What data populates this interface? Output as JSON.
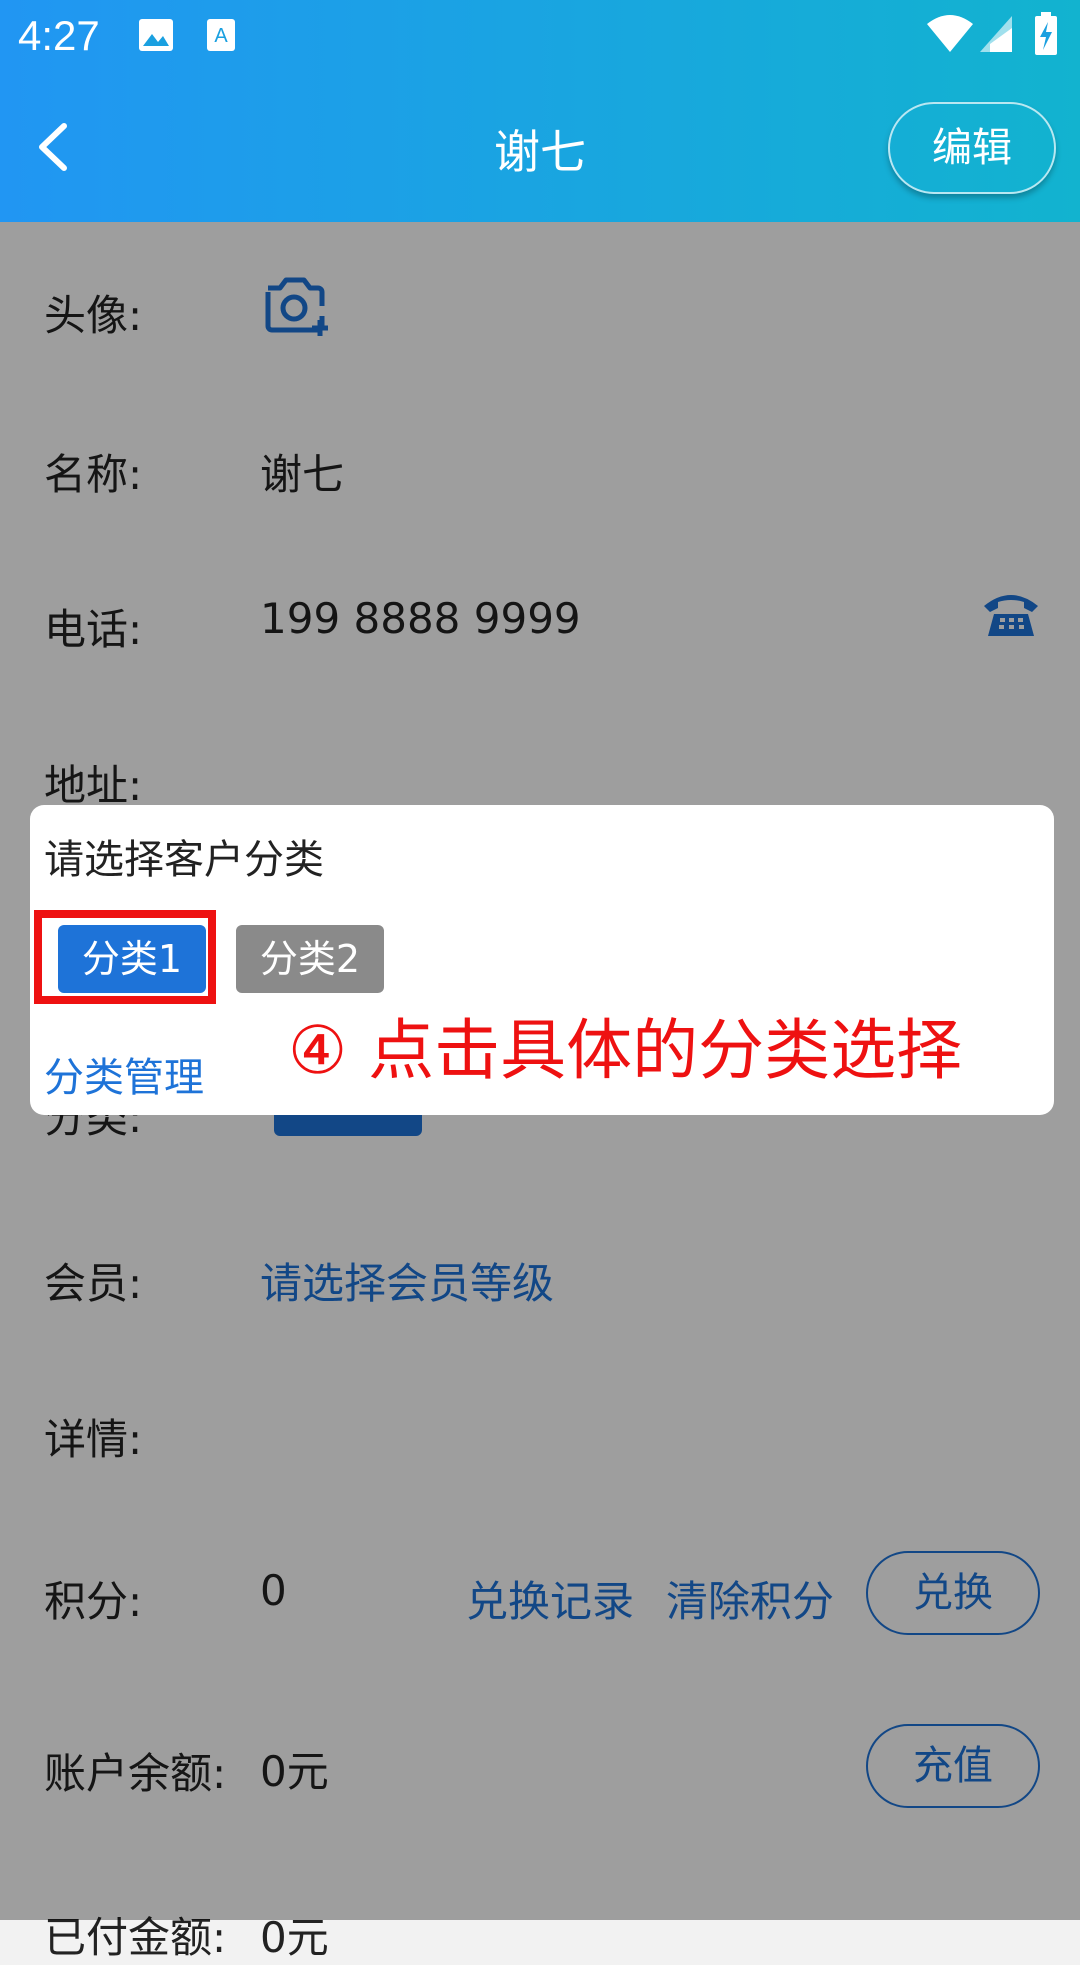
{
  "status_bar": {
    "time": "4:27"
  },
  "app_bar": {
    "title": "谢七",
    "edit_label": "编辑"
  },
  "rows": {
    "avatar": {
      "label": "头像:"
    },
    "name": {
      "label": "名称:",
      "value": "谢七"
    },
    "phone": {
      "label": "电话:",
      "value": "199 8888 9999"
    },
    "address": {
      "label": "地址:"
    },
    "category": {
      "label": "分类:"
    },
    "member": {
      "label": "会员:",
      "value": "请选择会员等级"
    },
    "details": {
      "label": "详情:"
    },
    "points": {
      "label": "积分:",
      "value": "0",
      "exchange_record": "兑换记录",
      "clear_points": "清除积分",
      "exchange": "兑换"
    },
    "balance": {
      "label": "账户余额:",
      "value": "0元",
      "recharge": "充值"
    },
    "paid": {
      "label": "已付金额:",
      "value": "0元"
    }
  },
  "dialog": {
    "title": "请选择客户分类",
    "categories": [
      "分类1",
      "分类2"
    ],
    "manage_link": "分类管理",
    "annotation": "④ 点击具体的分类选择"
  },
  "colors": {
    "accent": "#1e73d8",
    "annotation": "#ee1111",
    "appbar_start": "#2196f3",
    "appbar_end": "#12b3cf"
  }
}
